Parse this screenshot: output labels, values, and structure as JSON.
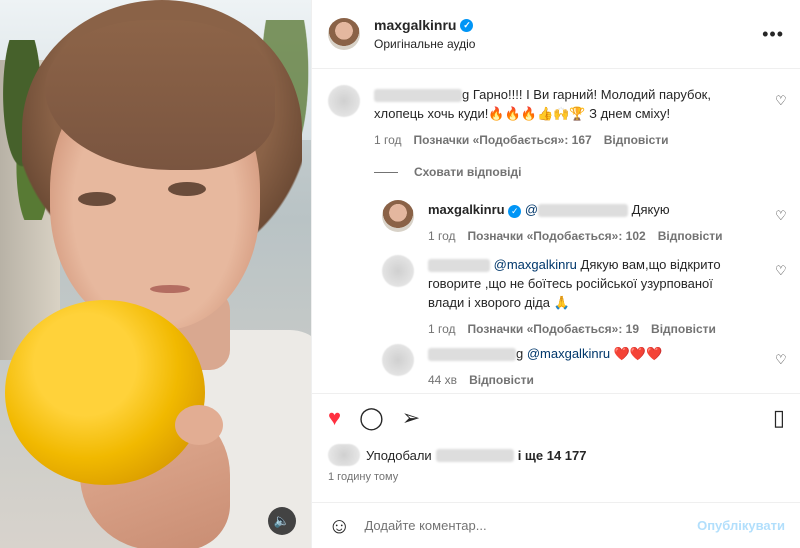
{
  "header": {
    "username": "maxgalkinru",
    "verified_mark": "✓",
    "subtitle": "Оригінальне аудіо",
    "more_label": "•••"
  },
  "comments": [
    {
      "text": "g Гарно!!!! І Ви гарний! Молодий парубок, хлопець хочь куди!🔥🔥🔥👍🙌🏆 З днем сміху!",
      "line1": "g Гарно!!!! І Ви гарний! Молодий парубок,",
      "line2": "хлопець хочь куди!🔥🔥🔥👍🙌🏆 З днем сміху!",
      "time": "1 год",
      "likes": "Позначки «Подобається»: 167",
      "reply": "Відповісти"
    }
  ],
  "hide_replies": "Сховати відповіді",
  "replies": [
    {
      "username": "maxgalkinru",
      "mention_tail": "Дякую",
      "mention_prefix": "@",
      "time": "1 год",
      "likes": "Позначки «Подобається»: 102",
      "reply": "Відповісти"
    },
    {
      "mention": "@maxgalkinru",
      "line1": " Дякую вам,що відкрито",
      "line2": "говорите ,що не боїтесь російської узурпованої",
      "line3": "влади і хворого діда 🙏",
      "time": "1 год",
      "likes": "Позначки «Подобається»: 19",
      "reply": "Відповісти"
    },
    {
      "prefix": "g ",
      "mention": "@maxgalkinru",
      "hearts": " ❤️❤️❤️",
      "time": "44 хв",
      "reply": "Відповісти"
    }
  ],
  "actions": {
    "like_icon": "♥",
    "comment_icon": "◯",
    "share_icon": "➢",
    "save_icon": "▯"
  },
  "likes_row": {
    "prefix": "Уподобали",
    "suffix": "і ще 14 177"
  },
  "post_time": "1 годину тому",
  "add_comment": {
    "emoji_icon": "☺",
    "placeholder": "Додайте коментар...",
    "post_label": "Опублікувати"
  },
  "media": {
    "sound_icon": "🔈"
  },
  "colors": {
    "like_red": "#ff3040",
    "verified_blue": "#0095f6",
    "post_disabled": "#b2dffc",
    "mention_blue": "#00376b"
  }
}
